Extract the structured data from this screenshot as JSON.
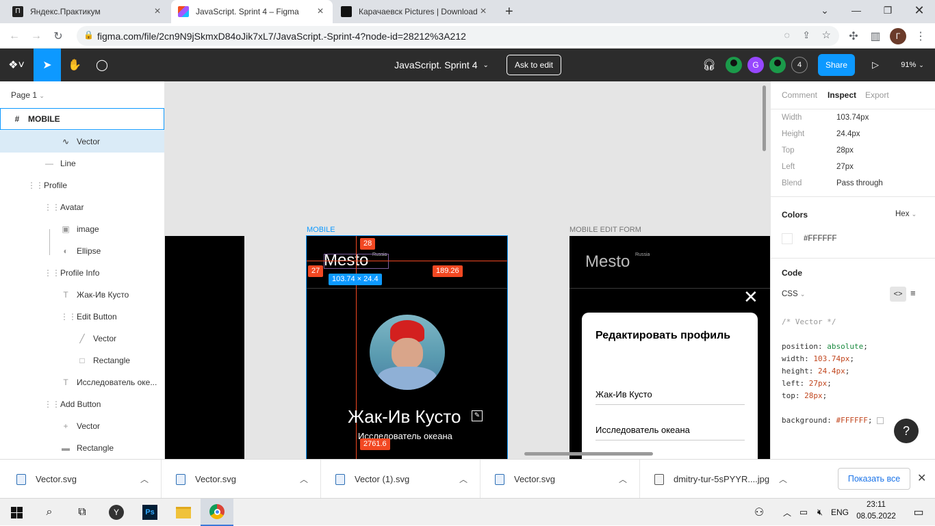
{
  "browser": {
    "tabs": [
      {
        "title": "Яндекс.Практикум",
        "active": false
      },
      {
        "title": "JavaScript. Sprint 4 – Figma",
        "active": true
      },
      {
        "title": "Карачаевск Pictures | Download",
        "active": false
      }
    ],
    "new_tab": "+",
    "url": "figma.com/file/2cn9N9jSkmxD84oJik7xL7/JavaScript.-Sprint-4?node-id=28212%3A212",
    "profile_initial": "Г"
  },
  "figma": {
    "file_title": "JavaScript. Sprint 4",
    "ask_to_edit": "Ask to edit",
    "avatar_g": "G",
    "viewer_count": "4",
    "share": "Share",
    "zoom": "91%"
  },
  "layers": {
    "page": "Page 1",
    "items": [
      {
        "label": "MOBILE",
        "icon": "#"
      },
      {
        "label": "Vector",
        "icon": "vector"
      },
      {
        "label": "Line",
        "icon": "line"
      },
      {
        "label": "Profile",
        "icon": "frame"
      },
      {
        "label": "Avatar",
        "icon": "frame"
      },
      {
        "label": "image",
        "icon": "image"
      },
      {
        "label": "Ellipse",
        "icon": "ellipse"
      },
      {
        "label": "Profile Info",
        "icon": "frame"
      },
      {
        "label": "Жак-Ив Кусто",
        "icon": "text"
      },
      {
        "label": "Edit Button",
        "icon": "frame"
      },
      {
        "label": "Vector",
        "icon": "pen"
      },
      {
        "label": "Rectangle",
        "icon": "rect"
      },
      {
        "label": "Исследователь оке...",
        "icon": "text"
      },
      {
        "label": "Add Button",
        "icon": "frame"
      },
      {
        "label": "Vector",
        "icon": "plus"
      },
      {
        "label": "Rectangle",
        "icon": "minus"
      }
    ]
  },
  "canvas": {
    "frame1_label": "MOBILE",
    "frame2_label": "MOBILE EDIT FORM",
    "logo": "Mesto",
    "logo_sup": "Russia",
    "measure_top": "28",
    "measure_left": "27",
    "measure_right": "189.26",
    "size_badge": "103.74 × 24.4",
    "measure_bottom": "2761.6",
    "profile_name": "Жак-Ив Кусто",
    "profile_job": "Исследователь океана",
    "popup_title": "Редактировать профиль",
    "popup_name": "Жак-Ив Кусто",
    "popup_job": "Исследователь океана",
    "help": "?"
  },
  "inspect": {
    "tabs": [
      "Comment",
      "Inspect",
      "Export"
    ],
    "props": [
      {
        "name": "Width",
        "value": "103.74px"
      },
      {
        "name": "Height",
        "value": "24.4px"
      },
      {
        "name": "Top",
        "value": "28px"
      },
      {
        "name": "Left",
        "value": "27px"
      },
      {
        "name": "Blend",
        "value": "Pass through"
      }
    ],
    "colors_title": "Colors",
    "color_format": "Hex",
    "color_value": "#FFFFFF",
    "code_title": "Code",
    "code_lang": "CSS",
    "code_comment": "/* Vector */",
    "code_lines": [
      {
        "k": "position",
        "v": "absolute"
      },
      {
        "k": "width",
        "v": "103.74px"
      },
      {
        "k": "height",
        "v": "24.4px"
      },
      {
        "k": "left",
        "v": "27px"
      },
      {
        "k": "top",
        "v": "28px"
      }
    ],
    "code_bg_key": "background",
    "code_bg_val": "#FFFFFF"
  },
  "downloads": {
    "items": [
      "Vector.svg",
      "Vector.svg",
      "Vector (1).svg",
      "Vector.svg",
      "dmitry-tur-5sPYYR....jpg"
    ],
    "show_all": "Показать все"
  },
  "taskbar": {
    "lang": "ENG",
    "time": "23:11",
    "date": "08.05.2022"
  },
  "colors": {
    "figma_blue": "#0d99ff",
    "measure_red": "#f24822",
    "code_green": "#1a8a3f",
    "code_orange": "#c1461e"
  }
}
